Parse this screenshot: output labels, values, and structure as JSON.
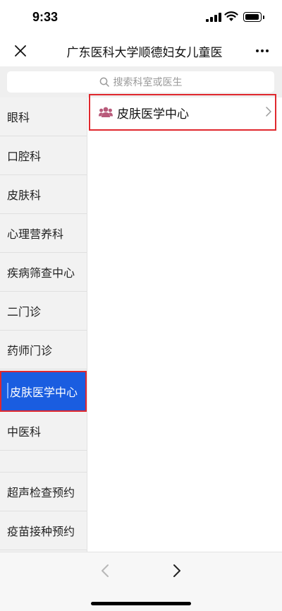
{
  "status_bar": {
    "time": "9:33"
  },
  "nav": {
    "title": "广东医科大学顺德妇女儿童医"
  },
  "search": {
    "placeholder": "搜索科室或医生"
  },
  "sidebar": {
    "items": [
      {
        "label": "眼科"
      },
      {
        "label": "口腔科"
      },
      {
        "label": "皮肤科"
      },
      {
        "label": "心理营养科"
      },
      {
        "label": "疾病筛查中心"
      },
      {
        "label": "二门诊"
      },
      {
        "label": "药师门诊"
      },
      {
        "label": "皮肤医学中心",
        "active": true
      },
      {
        "label": "中医科"
      },
      {
        "label": ""
      },
      {
        "label": "超声检查预约"
      },
      {
        "label": "疫苗接种预约"
      }
    ]
  },
  "content": {
    "departments": [
      {
        "label": "皮肤医学中心",
        "icon": "group-icon"
      }
    ]
  },
  "colors": {
    "active_bg": "#1a5de0",
    "highlight_border": "#e0282e",
    "icon_color": "#b85a7a"
  }
}
